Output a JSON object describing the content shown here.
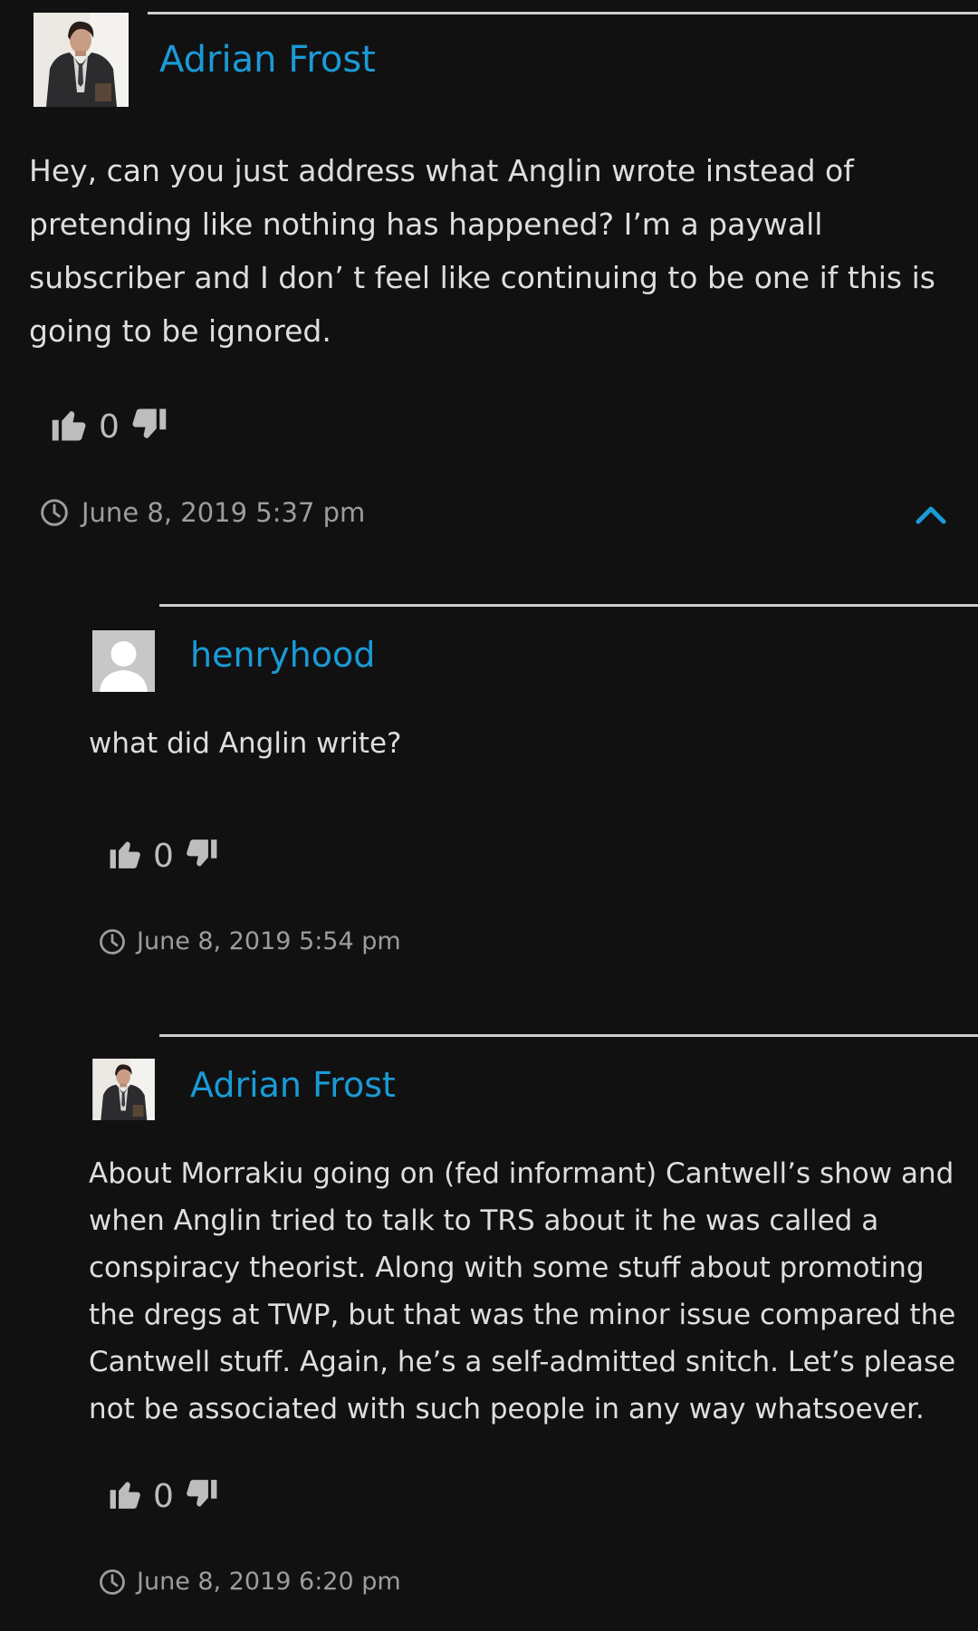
{
  "colors": {
    "background": "#111111",
    "author_link": "#1b9ad6",
    "body_text": "#dedede",
    "meta_text": "#9d9d9d",
    "divider": "#cfcfcf"
  },
  "comments": [
    {
      "author": "Adrian Frost",
      "avatar_icon": "portrait-avatar",
      "text": "Hey, can you just address what Anglin wrote instead of pretending like nothing has happened? I’m a paywall subscriber and I don’ t feel like continuing to be one if this is going to be ignored.",
      "votes": "0",
      "timestamp": "June 8, 2019 5:37 pm",
      "collapse_icon": "chevron-up-icon"
    },
    {
      "author": "henryhood",
      "avatar_icon": "default-user-avatar",
      "text": "what did Anglin write?",
      "votes": "0",
      "timestamp": "June 8, 2019 5:54 pm"
    },
    {
      "author": "Adrian Frost",
      "avatar_icon": "portrait-avatar",
      "text": "About Morrakiu going on (fed informant) Cantwell’s show and when Anglin tried to talk to TRS about it he was called a conspiracy theorist. Along with some stuff about promoting the dregs at TWP, but that was the minor issue compared the Cantwell stuff. Again, he’s a self-admitted snitch. Let’s please not be associated with such people in any way whatsoever.",
      "votes": "0",
      "timestamp": "June 8, 2019 6:20 pm"
    }
  ]
}
